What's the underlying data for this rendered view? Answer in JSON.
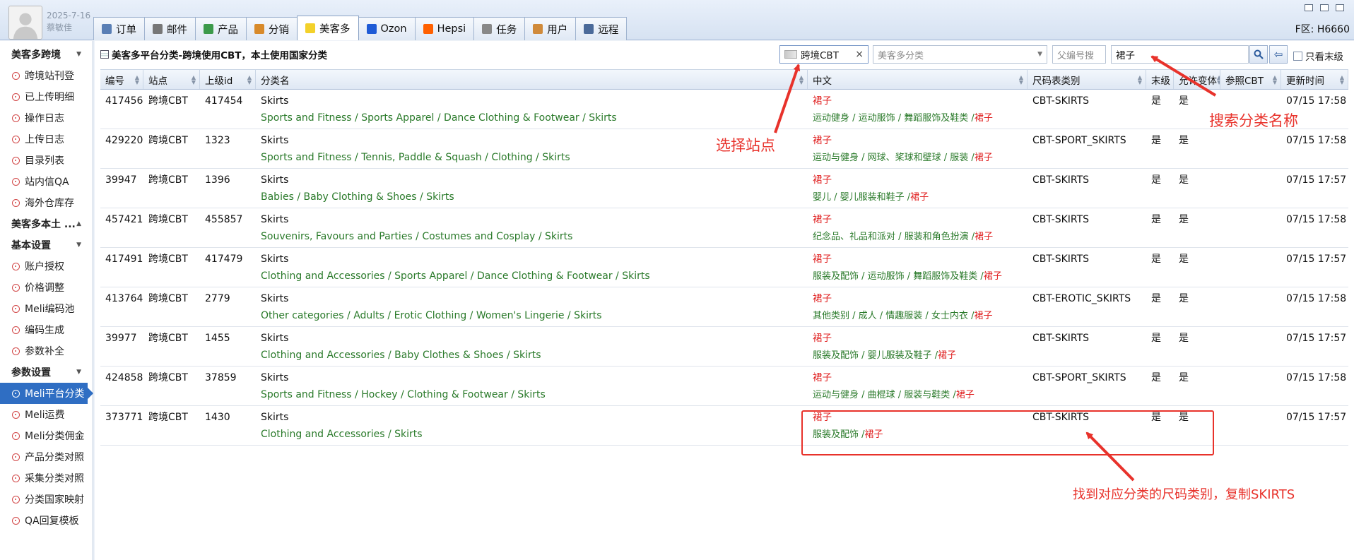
{
  "user": {
    "date": "2025-7-16",
    "name": "蔡敏佳"
  },
  "tabs": [
    {
      "label": "订单",
      "icon": "order-icon",
      "color": "#5a7fb5"
    },
    {
      "label": "邮件",
      "icon": "mail-icon",
      "color": "#777777"
    },
    {
      "label": "产品",
      "icon": "product-icon",
      "color": "#3c9a4a"
    },
    {
      "label": "分销",
      "icon": "distribution-icon",
      "color": "#d88a2a"
    },
    {
      "label": "美客多",
      "icon": "mercadolibre-icon",
      "color": "#f3d12a",
      "active": true
    },
    {
      "label": "Ozon",
      "icon": "ozon-icon",
      "color": "#1f5bd6"
    },
    {
      "label": "Hepsi",
      "icon": "hepsi-icon",
      "color": "#ff6000"
    },
    {
      "label": "任务",
      "icon": "task-icon",
      "color": "#888888"
    },
    {
      "label": "用户",
      "icon": "user-icon",
      "color": "#d08a3a"
    },
    {
      "label": "远程",
      "icon": "remote-icon",
      "color": "#4b6a99"
    }
  ],
  "region": "F区: H6660",
  "sidebar": {
    "groups": [
      {
        "title": "美客多跨境",
        "caret": "▼",
        "items": [
          "跨境站刊登",
          "已上传明细",
          "操作日志",
          "上传日志",
          "目录列表",
          "站内信QA",
          "海外仓库存"
        ]
      },
      {
        "title": "美客多本土 ...",
        "caret": "▲",
        "items": []
      },
      {
        "title": "基本设置",
        "caret": "▼",
        "items": [
          "账户授权",
          "价格调整",
          "Meli编码池",
          "编码生成",
          "参数补全"
        ]
      },
      {
        "title": "参数设置",
        "caret": "▼",
        "items": [
          "Meli平台分类",
          "Meli运费",
          "Meli分类佣金",
          "产品分类对照",
          "采集分类对照",
          "分类国家映射",
          "QA回复模板"
        ]
      }
    ],
    "active_item": "Meli平台分类"
  },
  "page": {
    "header": "美客多平台分类-跨境使用CBT，本土使用国家分类",
    "site_filter": "跨境CBT",
    "site_clear": "×",
    "category_placeholder": "美客多分类",
    "parent_placeholder": "父编号搜",
    "search_value": "裙子",
    "only_last_label": "只看末级"
  },
  "table": {
    "columns": [
      "编号",
      "站点",
      "上级id",
      "分类名",
      "中文",
      "尺码表类别",
      "末级",
      "允许变体",
      "参照CBT",
      "更新时间"
    ],
    "rows": [
      {
        "id": "417456",
        "site": "跨境CBT",
        "parent_id": "417454",
        "name": "Skirts",
        "path": "Sports and Fitness / Sports Apparel / Dance Clothing & Footwear / Skirts",
        "zh": "裙子",
        "zh_path": "运动健身 / 运动服饰 / 舞蹈服饰及鞋类 /",
        "zh_tail": "裙子",
        "size": "CBT-SKIRTS",
        "last": "是",
        "variant": "是",
        "ref": "",
        "time": "07/15 17:58"
      },
      {
        "id": "429220",
        "site": "跨境CBT",
        "parent_id": "1323",
        "name": "Skirts",
        "path": "Sports and Fitness / Tennis, Paddle & Squash / Clothing / Skirts",
        "zh": "裙子",
        "zh_path": "运动与健身 / 网球、桨球和壁球 / 服装 /",
        "zh_tail": "裙子",
        "size": "CBT-SPORT_SKIRTS",
        "last": "是",
        "variant": "是",
        "ref": "",
        "time": "07/15 17:58"
      },
      {
        "id": "39947",
        "site": "跨境CBT",
        "parent_id": "1396",
        "name": "Skirts",
        "path": "Babies / Baby Clothing & Shoes / Skirts",
        "zh": "裙子",
        "zh_path": "婴儿 / 婴儿服装和鞋子 /",
        "zh_tail": "裙子",
        "size": "CBT-SKIRTS",
        "last": "是",
        "variant": "是",
        "ref": "",
        "time": "07/15 17:57"
      },
      {
        "id": "457421",
        "site": "跨境CBT",
        "parent_id": "455857",
        "name": "Skirts",
        "path": "Souvenirs, Favours and Parties / Costumes and Cosplay / Skirts",
        "zh": "裙子",
        "zh_path": "纪念品、礼品和派对 / 服装和角色扮演 /",
        "zh_tail": "裙子",
        "size": "CBT-SKIRTS",
        "last": "是",
        "variant": "是",
        "ref": "",
        "time": "07/15 17:58"
      },
      {
        "id": "417491",
        "site": "跨境CBT",
        "parent_id": "417479",
        "name": "Skirts",
        "path": "Clothing and Accessories / Sports Apparel / Dance Clothing & Footwear / Skirts",
        "zh": "裙子",
        "zh_path": "服装及配饰 / 运动服饰 / 舞蹈服饰及鞋类 /",
        "zh_tail": "裙子",
        "size": "CBT-SKIRTS",
        "last": "是",
        "variant": "是",
        "ref": "",
        "time": "07/15 17:57"
      },
      {
        "id": "413764",
        "site": "跨境CBT",
        "parent_id": "2779",
        "name": "Skirts",
        "path": "Other categories / Adults / Erotic Clothing / Women's Lingerie / Skirts",
        "zh": "裙子",
        "zh_path": "其他类别 / 成人 / 情趣服装 / 女士内衣 /",
        "zh_tail": "裙子",
        "size": "CBT-EROTIC_SKIRTS",
        "last": "是",
        "variant": "是",
        "ref": "",
        "time": "07/15 17:58"
      },
      {
        "id": "39977",
        "site": "跨境CBT",
        "parent_id": "1455",
        "name": "Skirts",
        "path": "Clothing and Accessories / Baby Clothes & Shoes / Skirts",
        "zh": "裙子",
        "zh_path": "服装及配饰 / 婴儿服装及鞋子 /",
        "zh_tail": "裙子",
        "size": "CBT-SKIRTS",
        "last": "是",
        "variant": "是",
        "ref": "",
        "time": "07/15 17:57"
      },
      {
        "id": "424858",
        "site": "跨境CBT",
        "parent_id": "37859",
        "name": "Skirts",
        "path": "Sports and Fitness / Hockey / Clothing & Footwear / Skirts",
        "zh": "裙子",
        "zh_path": "运动与健身 / 曲棍球 / 服装与鞋类 /",
        "zh_tail": "裙子",
        "size": "CBT-SPORT_SKIRTS",
        "last": "是",
        "variant": "是",
        "ref": "",
        "time": "07/15 17:58"
      },
      {
        "id": "373771",
        "site": "跨境CBT",
        "parent_id": "1430",
        "name": "Skirts",
        "path": "Clothing and Accessories / Skirts",
        "zh": "裙子",
        "zh_path": "服装及配饰 /",
        "zh_tail": "裙子",
        "size": "CBT-SKIRTS",
        "last": "是",
        "variant": "是",
        "ref": "",
        "time": "07/15 17:57"
      }
    ]
  },
  "annotations": {
    "site": "选择站点",
    "search": "搜索分类名称",
    "result": "找到对应分类的尺码类别，复制SKIRTS",
    "color": "#e8322b"
  }
}
